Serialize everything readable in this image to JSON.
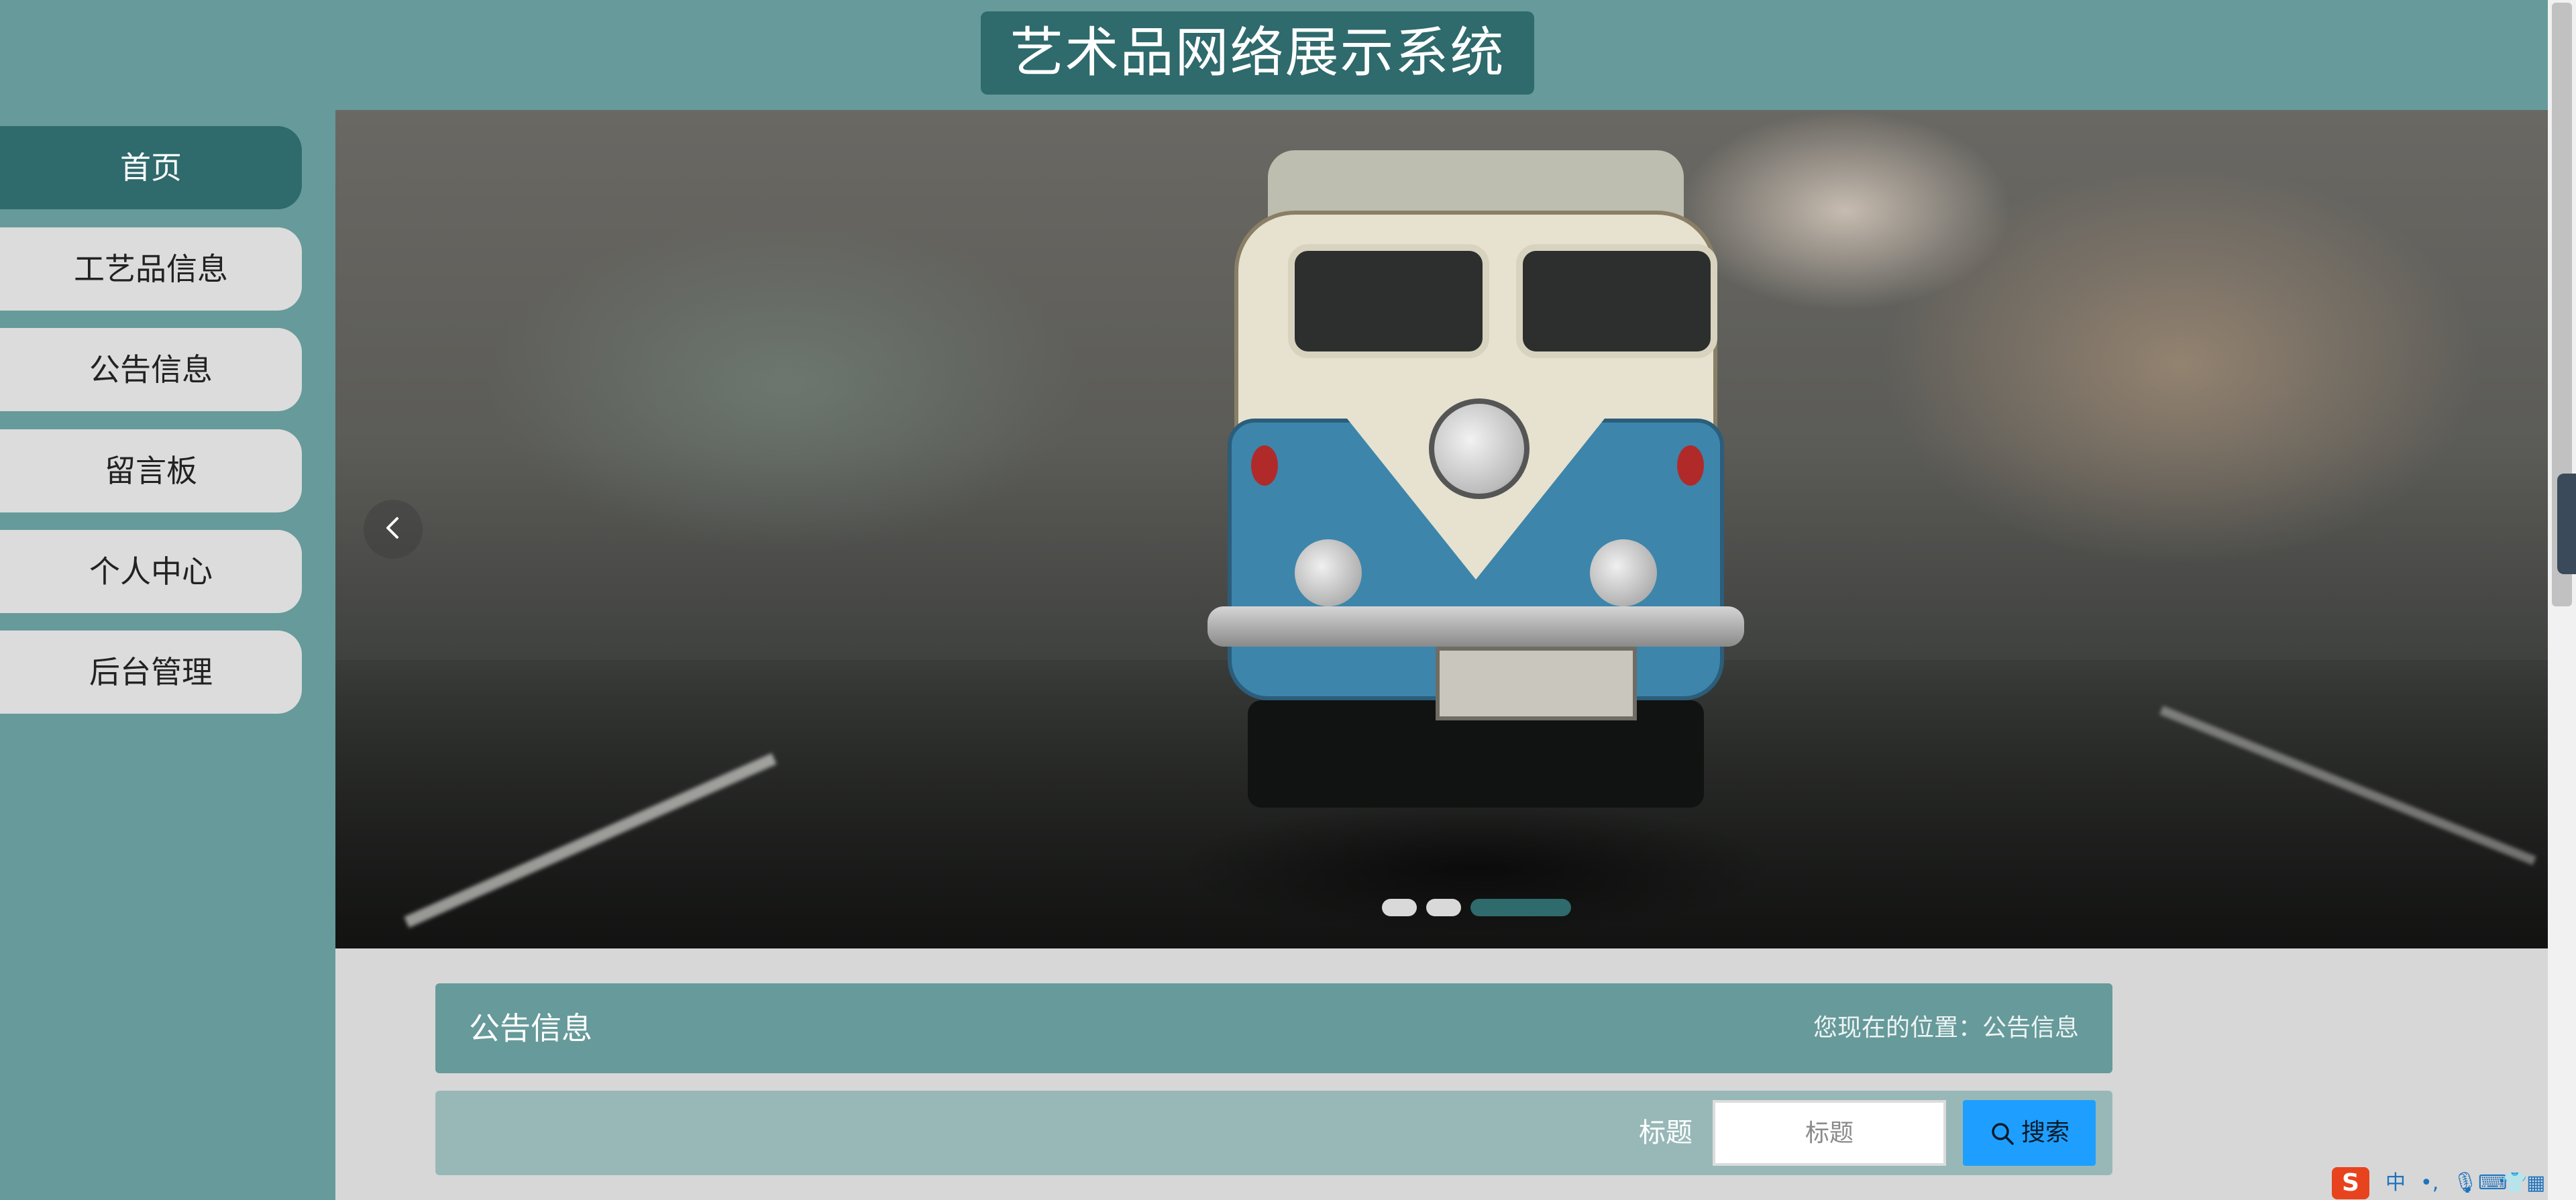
{
  "header": {
    "title": "艺术品网络展示系统"
  },
  "sidebar": {
    "items": [
      {
        "label": "首页",
        "active": true
      },
      {
        "label": "工艺品信息",
        "active": false
      },
      {
        "label": "公告信息",
        "active": false
      },
      {
        "label": "留言板",
        "active": false
      },
      {
        "label": "个人中心",
        "active": false
      },
      {
        "label": "后台管理",
        "active": false
      }
    ]
  },
  "banner": {
    "prev_icon": "chevron-left-icon",
    "slide_count": 3,
    "active_slide": 3
  },
  "notice": {
    "title": "公告信息",
    "breadcrumb": "您现在的位置：公告信息"
  },
  "search": {
    "label": "标题",
    "placeholder": "标题",
    "value": "",
    "button_label": "搜索"
  },
  "ime": {
    "logo": "S",
    "mode": "中",
    "punct": "•,",
    "mic": "🎙",
    "keyboard": "⌨",
    "skin": "👕",
    "menu": "▦"
  },
  "colors": {
    "primary": "#679a9a",
    "dark": "#2f6a6c",
    "search_button": "#1e9fff",
    "content_bg": "#d7d7d7"
  }
}
